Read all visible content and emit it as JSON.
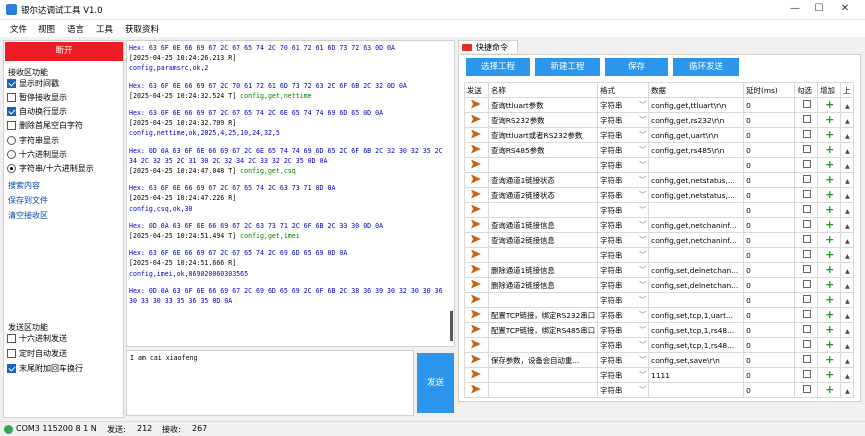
{
  "window": {
    "title": "银尔达调试工具 V1.0",
    "min": "—",
    "max": "☐",
    "close": "✕"
  },
  "menu": [
    "文件",
    "视图",
    "语言",
    "工具",
    "获取资料"
  ],
  "left": {
    "disconnect_label": "断开",
    "recv_section": "接收区功能",
    "recv_options": [
      {
        "label": "显示时间戳",
        "checked": true
      },
      {
        "label": "暂停接收显示",
        "checked": false
      },
      {
        "label": "自动换行显示",
        "checked": true
      },
      {
        "label": "删除首尾空白字符",
        "checked": false
      }
    ],
    "display_modes": [
      {
        "label": "字符串显示",
        "selected": false
      },
      {
        "label": "十六进制显示",
        "selected": false
      },
      {
        "label": "字符串/十六进制显示",
        "selected": true
      }
    ],
    "links": [
      "搜索内容",
      "保存到文件",
      "清空接收区"
    ],
    "send_section": "发送区功能",
    "send_options": [
      {
        "label": "十六进制发送",
        "checked": false
      },
      {
        "label": "定时自动发送",
        "checked": false
      },
      {
        "label": "末尾附加回车换行",
        "checked": true
      }
    ]
  },
  "receive_log": [
    {
      "cls": "hex",
      "text": "Hex: 63 6F 6E 66 69 67 2C 67 65 74 2C 70 61 72 61 6D 73 72 63 0D 0A"
    },
    {
      "cls": "ts",
      "text": "[2025-04-25 10:24:26.213 R]"
    },
    {
      "cls": "rsp",
      "text": "config,paramsrc,ok,2"
    },
    {
      "cls": "gap",
      "text": ""
    },
    {
      "cls": "hex",
      "text": "Hex: 63 6F 6E 66 69 67 2C 70 61 72 61 6D 73 72 63 2C 6F 6B 2C 32 0D 0A"
    },
    {
      "cls": "tsc",
      "text": "[2025-04-25 10:24:32.524 T]",
      "cmd": " config,get,nettime"
    },
    {
      "cls": "gap",
      "text": ""
    },
    {
      "cls": "hex",
      "text": "Hex: 63 6F 6E 66 69 67 2C 67 65 74 2C 6E 65 74 74 69 6D 65 0D 0A"
    },
    {
      "cls": "ts",
      "text": "[2025-04-25 10:24:32.709 R]"
    },
    {
      "cls": "rsp",
      "text": "config,nettime,ok,2025,4,25,10,24,32,5"
    },
    {
      "cls": "gap",
      "text": ""
    },
    {
      "cls": "hex",
      "text": "Hex: 0D 0A 63 6F 6E 66 69 67 2C 6E 65 74 74 69 6D 65 2C 6F 6B 2C 32 30 32 35 2C"
    },
    {
      "cls": "hex",
      "text": "34 2C 32 35 2C 31 30 2C 32 34 2C 33 32 2C 35 0D 0A"
    },
    {
      "cls": "tsc",
      "text": "[2025-04-25 10:24:47.048 T]",
      "cmd": " config,get,csq"
    },
    {
      "cls": "gap",
      "text": ""
    },
    {
      "cls": "hex",
      "text": "Hex: 63 6F 6E 66 69 67 2C 67 65 74 2C 63 73 71 0D 0A"
    },
    {
      "cls": "ts",
      "text": "[2025-04-25 10:24:47.226 R]"
    },
    {
      "cls": "rsp",
      "text": "config,csq,ok,30"
    },
    {
      "cls": "gap",
      "text": ""
    },
    {
      "cls": "hex",
      "text": "Hex: 0D 0A 63 6F 6E 66 69 67 2C 63 73 71 2C 6F 6B 2C 33 30 0D 0A"
    },
    {
      "cls": "tsc",
      "text": "[2025-04-25 10:24:51.494 T]",
      "cmd": " config,get,imei"
    },
    {
      "cls": "gap",
      "text": ""
    },
    {
      "cls": "hex",
      "text": "Hex: 63 6F 6E 66 69 67 2C 67 65 74 2C 69 6D 65 69 0D 0A"
    },
    {
      "cls": "ts",
      "text": "[2025-04-25 10:24:51.666 R]"
    },
    {
      "cls": "rsp",
      "text": "config,imei,ok,869020060303565"
    },
    {
      "cls": "gap",
      "text": ""
    },
    {
      "cls": "hex",
      "text": "Hex: 0D 0A 63 6F 6E 66 69 67 2C 69 6D 65 69 2C 6F 6B 2C 38 36 39 30 32 30 30 36"
    },
    {
      "cls": "hex",
      "text": "30 33 30 33 35 36 35 0D 0A"
    }
  ],
  "send_text": "I am cai xiaofeng",
  "send_label": "发送",
  "tab_label": "快捷命令",
  "toolbar": {
    "select": "选择工程",
    "new": "新建工程",
    "save": "保存",
    "loop": "循环发送"
  },
  "table": {
    "headers": [
      "发送",
      "名称",
      "格式",
      "数据",
      "延时(ms)",
      "勾选",
      "增加",
      "上"
    ],
    "rows": [
      {
        "name": "查询ttluart参数",
        "format": "字符串",
        "data": "config,get,ttluart\\r\\n",
        "delay": "0"
      },
      {
        "name": "查询RS232参数",
        "format": "字符串",
        "data": "config,get,rs232\\r\\n",
        "delay": "0"
      },
      {
        "name": "查询ttluart或者RS232参数",
        "format": "字符串",
        "data": "config,get,uart\\r\\n",
        "delay": "0"
      },
      {
        "name": "查询RS485参数",
        "format": "字符串",
        "data": "config,get,rs485\\r\\n",
        "delay": "0"
      },
      {
        "name": "",
        "format": "字符串",
        "data": "",
        "delay": "0"
      },
      {
        "name": "查询通道1链接状态",
        "format": "字符串",
        "data": "config,get,netstatus,...",
        "delay": "0"
      },
      {
        "name": "查询通道2链接状态",
        "format": "字符串",
        "data": "config,get,netstatus,...",
        "delay": "0"
      },
      {
        "name": "",
        "format": "字符串",
        "data": "",
        "delay": "0"
      },
      {
        "name": "查询通道1链接信息",
        "format": "字符串",
        "data": "config,get,netchaninf...",
        "delay": "0"
      },
      {
        "name": "查询通道2链接信息",
        "format": "字符串",
        "data": "config,get,netchaninf...",
        "delay": "0"
      },
      {
        "name": "",
        "format": "字符串",
        "data": "",
        "delay": "0"
      },
      {
        "name": "删除通道1链接信息",
        "format": "字符串",
        "data": "config,set,delnetchan...",
        "delay": "0"
      },
      {
        "name": "删除通道2链接信息",
        "format": "字符串",
        "data": "config,set,delnetchan...",
        "delay": "0"
      },
      {
        "name": "",
        "format": "字符串",
        "data": "",
        "delay": "0"
      },
      {
        "name": "配置TCP链接，绑定RS232串口",
        "format": "字符串",
        "data": "config,set,tcp,1,uart...",
        "delay": "0"
      },
      {
        "name": "配置TCP链接，绑定RS485串口",
        "format": "字符串",
        "data": "config,set,tcp,1,rs48...",
        "delay": "0"
      },
      {
        "name": "",
        "format": "字符串",
        "data": "config,set,tcp,1,rs48...",
        "delay": "0"
      },
      {
        "name": "保存参数，设备会自动重...",
        "format": "字符串",
        "data": "config,set,save\\r\\n",
        "delay": "0"
      },
      {
        "name": "",
        "format": "字符串",
        "data": "1111",
        "delay": "0"
      },
      {
        "name": "",
        "format": "字符串",
        "data": "",
        "delay": "0"
      }
    ]
  },
  "status": {
    "port": "COM3 115200 8 1 N",
    "sent_label": "发送:",
    "sent": "212",
    "recv_label": "接收:",
    "recv": "267"
  }
}
